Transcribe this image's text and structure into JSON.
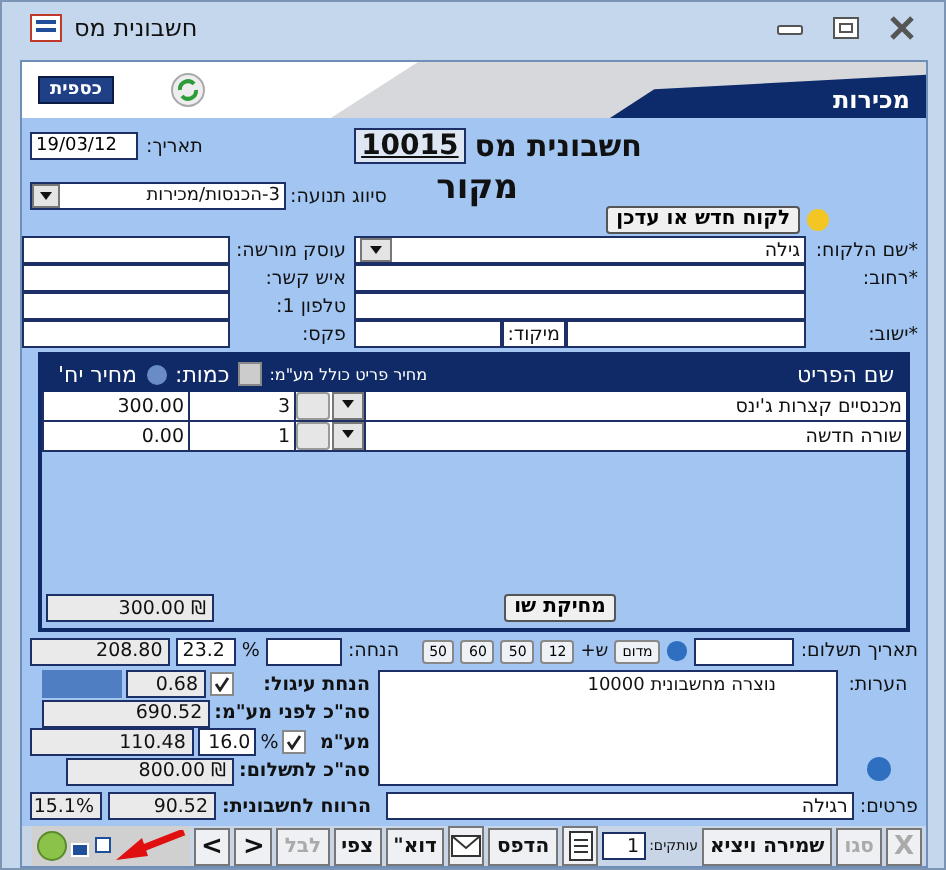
{
  "window": {
    "title": "חשבונית מס"
  },
  "header": {
    "logo": "כספית",
    "section": "מכירות"
  },
  "invoice": {
    "date_label": "תאריך:",
    "date": "19/03/12",
    "title": "חשבונית מס",
    "number": "10015",
    "copy_type": "מקור"
  },
  "movement": {
    "label": "סיווג תנועה:",
    "value": "3-הכנסות/מכירות"
  },
  "new_customer_button": "לקוח חדש או עדכן",
  "customer_fields": [
    {
      "kind": "dropdown",
      "label": "*שם הלקוח:",
      "value": "גילה"
    },
    {
      "kind": "text",
      "label": "*רחוב:"
    },
    {
      "kind": "text"
    },
    {
      "kind": "split",
      "label": "*ישוב:",
      "sub_label": "מיקוד:"
    }
  ],
  "contact_fields": [
    {
      "label": "עוסק מורשה:"
    },
    {
      "label": "איש קשר:"
    },
    {
      "label": "טלפון 1:"
    },
    {
      "label": "פקס:"
    }
  ],
  "items": {
    "name_header": "שם הפריט",
    "price_incl_label": "מחיר פריט כולל מע\"מ:",
    "price_incl_checked": false,
    "quantity_header": "כמות:",
    "unit_price_header": "מחיר יח'",
    "rows": [
      {
        "name": "מכנסיים קצרות ג'ינס",
        "quantity": "3",
        "unit_price": "300.00"
      },
      {
        "name": "שורה חדשה",
        "quantity": "1",
        "unit_price": "0.00"
      }
    ],
    "total": "300.00 ₪",
    "delete_button": "מחיקת שו"
  },
  "discount": {
    "amount": "208.80",
    "percent": "23.2",
    "percent_sign": "%",
    "label": "הנחה:",
    "quick_buttons": [
      "12",
      "50",
      "60",
      "50"
    ],
    "plus_label": "ש+",
    "more_button": "מדום"
  },
  "payment_date": {
    "label": "תאריך תשלום:"
  },
  "rounding": {
    "label": "הנחת עיגול:",
    "value": "0.68",
    "checked": true
  },
  "before_vat": {
    "label": "סה\"כ לפני מע\"מ:",
    "value": "690.52"
  },
  "vat": {
    "label": "מע\"מ",
    "value": "110.48",
    "rate": "16.0",
    "percent_sign": "%",
    "checked": true
  },
  "total_to_pay": {
    "label": "סה\"כ לתשלום:",
    "value": "800.00 ₪"
  },
  "profit": {
    "label": "הרווח לחשבונית:",
    "value": "90.52",
    "percent": "15.1%"
  },
  "notes": {
    "label": "הערות:",
    "value": "נוצרה מחשבונית 10000"
  },
  "details": {
    "label": "פרטים:",
    "value": "רגילה"
  },
  "toolbar": [
    {
      "kind": "glyph",
      "text": "X",
      "disabled": true
    },
    {
      "kind": "button",
      "text": "סגו",
      "disabled": true
    },
    {
      "kind": "button",
      "text": "שמירה ויציא",
      "disabled": false
    },
    {
      "kind": "copies",
      "label": "עותקים:",
      "value": "1"
    },
    {
      "kind": "doc_icon"
    },
    {
      "kind": "button",
      "text": "הדפס",
      "disabled": false
    },
    {
      "kind": "mail_icon"
    },
    {
      "kind": "button",
      "text": "דוא\"",
      "disabled": false
    },
    {
      "kind": "button",
      "text": "צפי",
      "disabled": false
    },
    {
      "kind": "button",
      "text": "לבל",
      "disabled": true
    },
    {
      "kind": "glyph",
      "text": "<",
      "disabled": false
    },
    {
      "kind": "glyph",
      "text": ">",
      "disabled": false
    },
    {
      "kind": "status_icon"
    }
  ]
}
